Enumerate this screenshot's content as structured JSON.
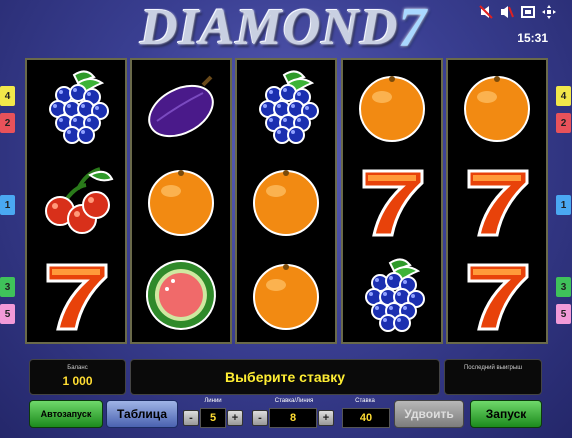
{
  "game": {
    "title_word": "DIAMOND",
    "title_number": "7",
    "clock": "15:31"
  },
  "top_icons": [
    "no-mute-icon",
    "sound-icon",
    "window-icon",
    "fullscreen-icon"
  ],
  "reels": [
    [
      "grapes",
      "cherries",
      "seven"
    ],
    [
      "plum",
      "orange",
      "watermelon"
    ],
    [
      "grapes",
      "orange",
      "orange"
    ],
    [
      "orange",
      "seven",
      "grapes"
    ],
    [
      "orange",
      "seven",
      "seven"
    ]
  ],
  "line_markers": {
    "left": [
      {
        "label": "4",
        "color": "#f2e84a"
      },
      {
        "label": "2",
        "color": "#e8525a"
      },
      {
        "label": "1",
        "color": "#4aa8f2"
      },
      {
        "label": "3",
        "color": "#3fc25a"
      },
      {
        "label": "5",
        "color": "#f29ad8"
      }
    ],
    "right": [
      {
        "label": "4",
        "color": "#f2e84a"
      },
      {
        "label": "2",
        "color": "#e8525a"
      },
      {
        "label": "1",
        "color": "#4aa8f2"
      },
      {
        "label": "3",
        "color": "#3fc25a"
      },
      {
        "label": "5",
        "color": "#f29ad8"
      }
    ]
  },
  "status": {
    "balance_label": "Баланс",
    "balance_value": "1 000",
    "message": "Выберите ставку",
    "last_win_label": "Последний выигрыш",
    "last_win_value": ""
  },
  "controls": {
    "autoplay": "Автозапуск",
    "table": "Таблица",
    "lines_label": "Линии",
    "lines_value": "5",
    "bet_per_line_label": "Ставка/Линия",
    "bet_per_line_value": "8",
    "bet_label": "Ставка",
    "bet_value": "40",
    "double": "Удвоить",
    "start": "Запуск",
    "minus": "-",
    "plus": "+"
  }
}
